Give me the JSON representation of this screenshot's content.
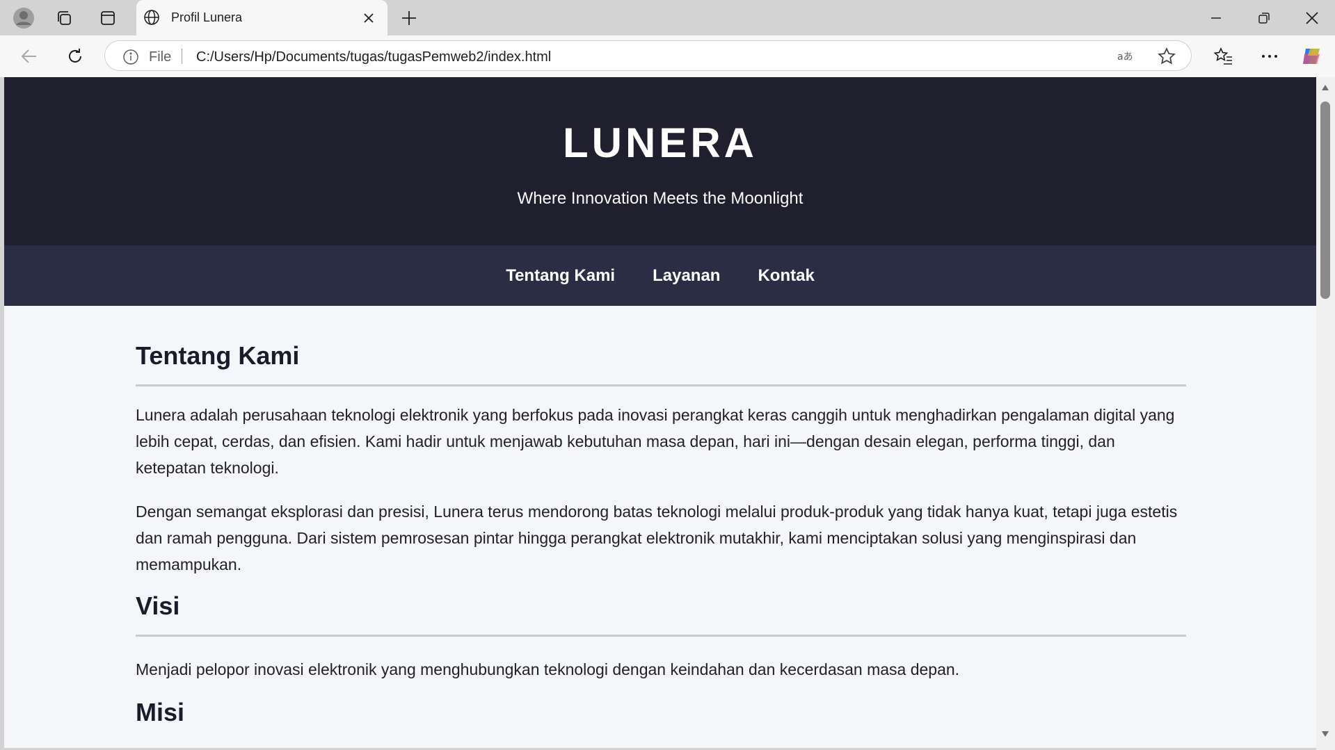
{
  "browser": {
    "tab_title": "Profil Lunera",
    "address_scheme": "File",
    "address_url": "C:/Users/Hp/Documents/tugas/tugasPemweb2/index.html",
    "icons": [
      "profile-icon",
      "workspaces-icon",
      "tab-actions-icon",
      "globe-icon",
      "close-icon",
      "new-tab-icon",
      "minimize-icon",
      "restore-icon",
      "window-close-icon",
      "back-icon",
      "refresh-icon",
      "info-icon",
      "read-aloud-icon",
      "favorite-star-icon",
      "favorites-icon",
      "more-icon",
      "copilot-icon"
    ]
  },
  "site": {
    "title": "LUNERA",
    "tagline": "Where Innovation Meets the Moonlight",
    "nav": [
      "Tentang Kami",
      "Layanan",
      "Kontak"
    ],
    "colors": {
      "header": "#1f1f2e",
      "nav": "#2b2d45",
      "background": "#f5f6fa"
    }
  },
  "about": {
    "heading": "Tentang Kami",
    "paragraphs": [
      "Lunera adalah perusahaan teknologi elektronik yang berfokus pada inovasi perangkat keras canggih untuk menghadirkan pengalaman digital yang lebih cepat, cerdas, dan efisien. Kami hadir untuk menjawab kebutuhan masa depan, hari ini—dengan desain elegan, performa tinggi, dan ketepatan teknologi.",
      "Dengan semangat eksplorasi dan presisi, Lunera terus mendorong batas teknologi melalui produk-produk yang tidak hanya kuat, tetapi juga estetis dan ramah pengguna. Dari sistem pemrosesan pintar hingga perangkat elektronik mutakhir, kami menciptakan solusi yang menginspirasi dan memampukan."
    ]
  },
  "vision": {
    "heading": "Visi",
    "text": "Menjadi pelopor inovasi elektronik yang menghubungkan teknologi dengan keindahan dan kecerdasan masa depan."
  },
  "mission": {
    "heading": "Misi"
  }
}
